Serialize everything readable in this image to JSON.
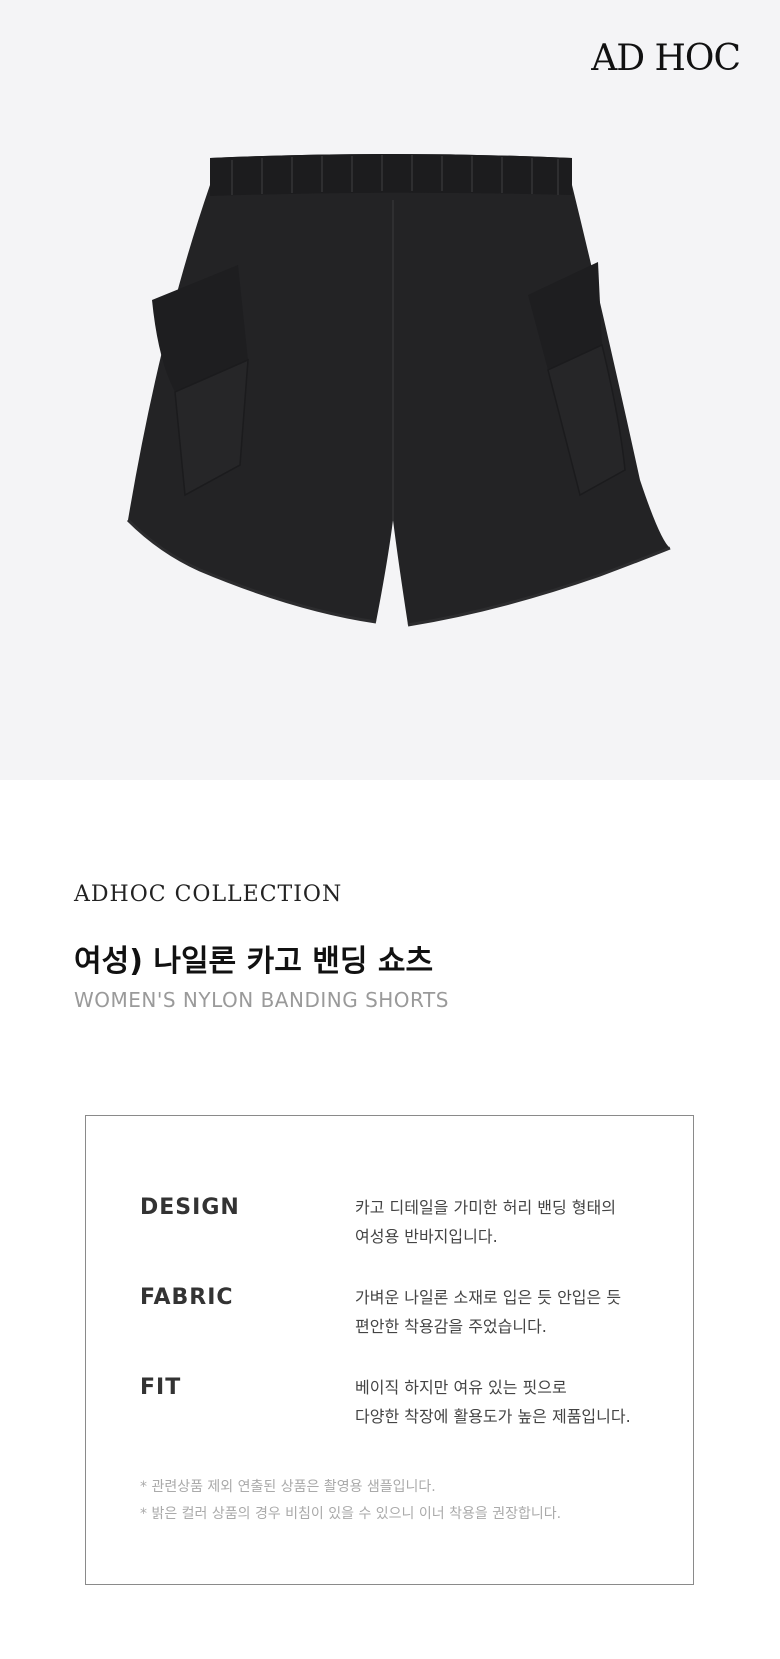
{
  "brand": {
    "logo_text": "AD HOC"
  },
  "product": {
    "image_alt": "black nylon cargo shorts",
    "collection_label": "ADHOC COLLECTION",
    "title_ko": "여성) 나일론 카고 밴딩 쇼츠",
    "title_en": "WOMEN'S NYLON BANDING SHORTS"
  },
  "details": [
    {
      "label": "DESIGN",
      "lines": [
        "카고 디테일을 가미한 허리 밴딩 형태의",
        "여성용 반바지입니다."
      ]
    },
    {
      "label": "FABRIC",
      "lines": [
        "가벼운 나일론 소재로 입은 듯 안입은 듯",
        "편안한 착용감을 주었습니다."
      ]
    },
    {
      "label": "FIT",
      "lines": [
        "베이직 하지만 여유 있는 핏으로",
        "다양한 착장에 활용도가 높은 제품입니다."
      ]
    }
  ],
  "notes": [
    "* 관련상품 제외 연출된 상품은 촬영용 샘플입니다.",
    "* 밝은 컬러 상품의 경우 비침이 있을 수 있으니 이너 착용을 권장합니다."
  ],
  "colors": {
    "hero_bg": "#f4f4f6",
    "garment": "#232325",
    "border": "#8a8a8a"
  }
}
